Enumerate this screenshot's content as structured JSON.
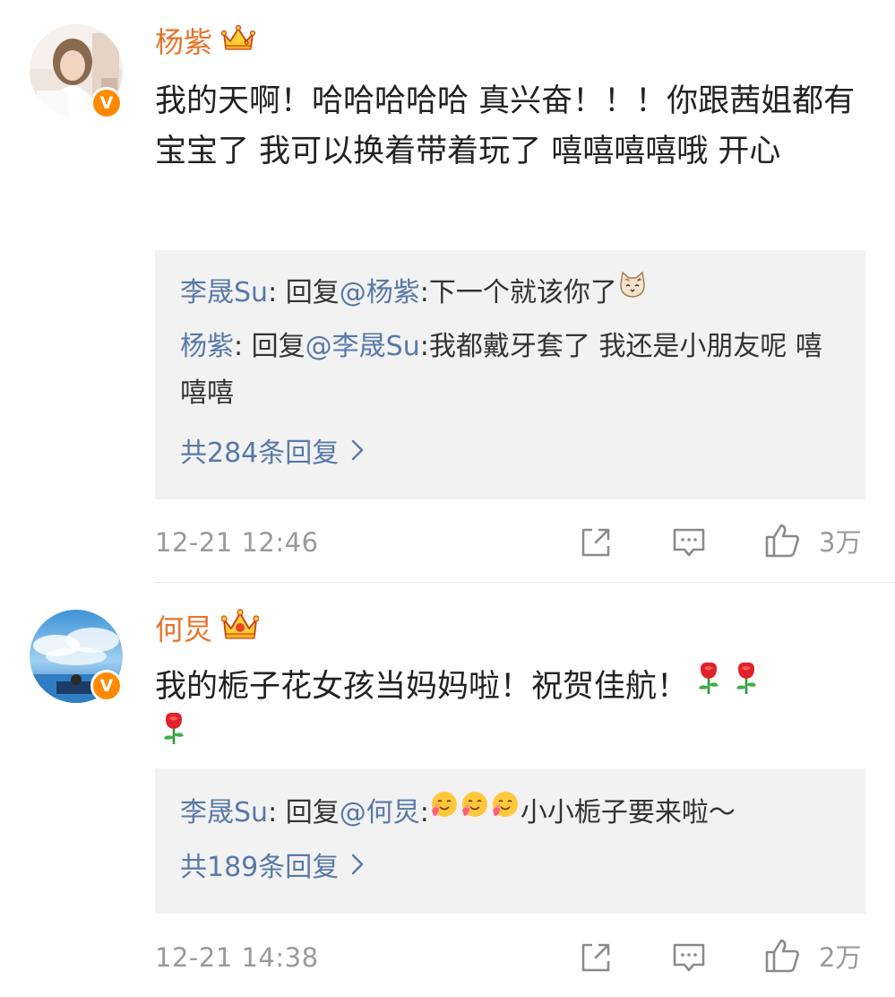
{
  "comments": [
    {
      "username": "杨紫",
      "text": "我的天啊！哈哈哈哈哈 真兴奋！！！你跟茜姐都有宝宝了 我可以换着带着玩了 嘻嘻嘻嘻哦 开心",
      "replies": [
        {
          "author": "李晟Su",
          "sep": ": 回复",
          "mention": "@杨紫",
          "text": ":下一个就该你了",
          "emoji": "cat-face-emoji"
        },
        {
          "author": "杨紫",
          "sep": ": 回复",
          "mention": "@李晟Su",
          "text": ":我都戴牙套了 我还是小朋友呢 嘻嘻嘻"
        }
      ],
      "total_replies": "共284条回复",
      "time": "12-21 12:46",
      "likes": "3万"
    },
    {
      "username": "何炅",
      "text": "我的栀子花女孩当妈妈啦！祝贺佳航！",
      "text_emoji": "rose-emoji",
      "replies": [
        {
          "author": "李晟Su",
          "sep": ": 回复",
          "mention": "@何炅",
          "text": "小小栀子要来啦～",
          "emoji": "hugging-face-emoji"
        }
      ],
      "total_replies": "共189条回复",
      "time": "12-21 14:38",
      "likes": "2万"
    }
  ],
  "colors": {
    "username": "#e8732a",
    "link": "#5879a8",
    "meta": "#9a9a9a",
    "reply_bg": "#f2f2f2",
    "verified": "#ff8a00"
  },
  "icons": {
    "crown": "crown-icon",
    "verified": "verified-v-icon",
    "repost": "repost-icon",
    "comment": "comment-icon",
    "like": "like-icon",
    "chevron": "chevron-right-icon"
  },
  "verified_label": "V"
}
